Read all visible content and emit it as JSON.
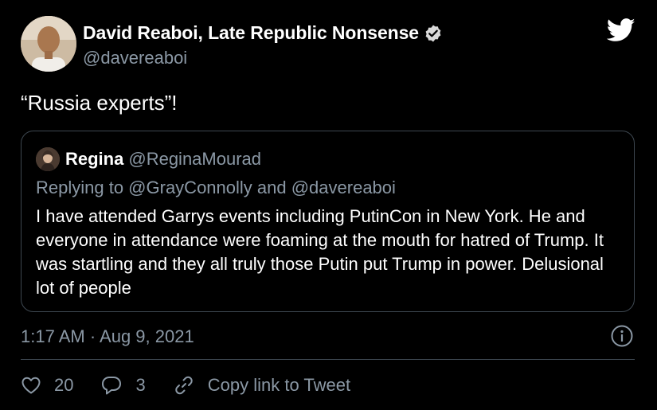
{
  "author": {
    "name": "David Reaboi, Late Republic Nonsense",
    "handle": "@davereaboi",
    "verified": true
  },
  "tweet_text": "“Russia experts”!",
  "quoted": {
    "name": "Regina",
    "handle": "@ReginaMourad",
    "replying_to": "Replying to @GrayConnolly and @davereaboi",
    "text": "I have attended Garrys events including PutinCon in New York. He and everyone in attendance were foaming at the mouth for hatred of Trump. It was startling and they all truly those Putin put Trump in power. Delusional lot of people"
  },
  "timestamp": "1:17 AM · Aug 9, 2021",
  "actions": {
    "likes": "20",
    "replies": "3",
    "copy_link": "Copy link to Tweet"
  },
  "colors": {
    "background": "#000000",
    "secondary_text": "#8b98a5",
    "border": "#3d4750"
  }
}
